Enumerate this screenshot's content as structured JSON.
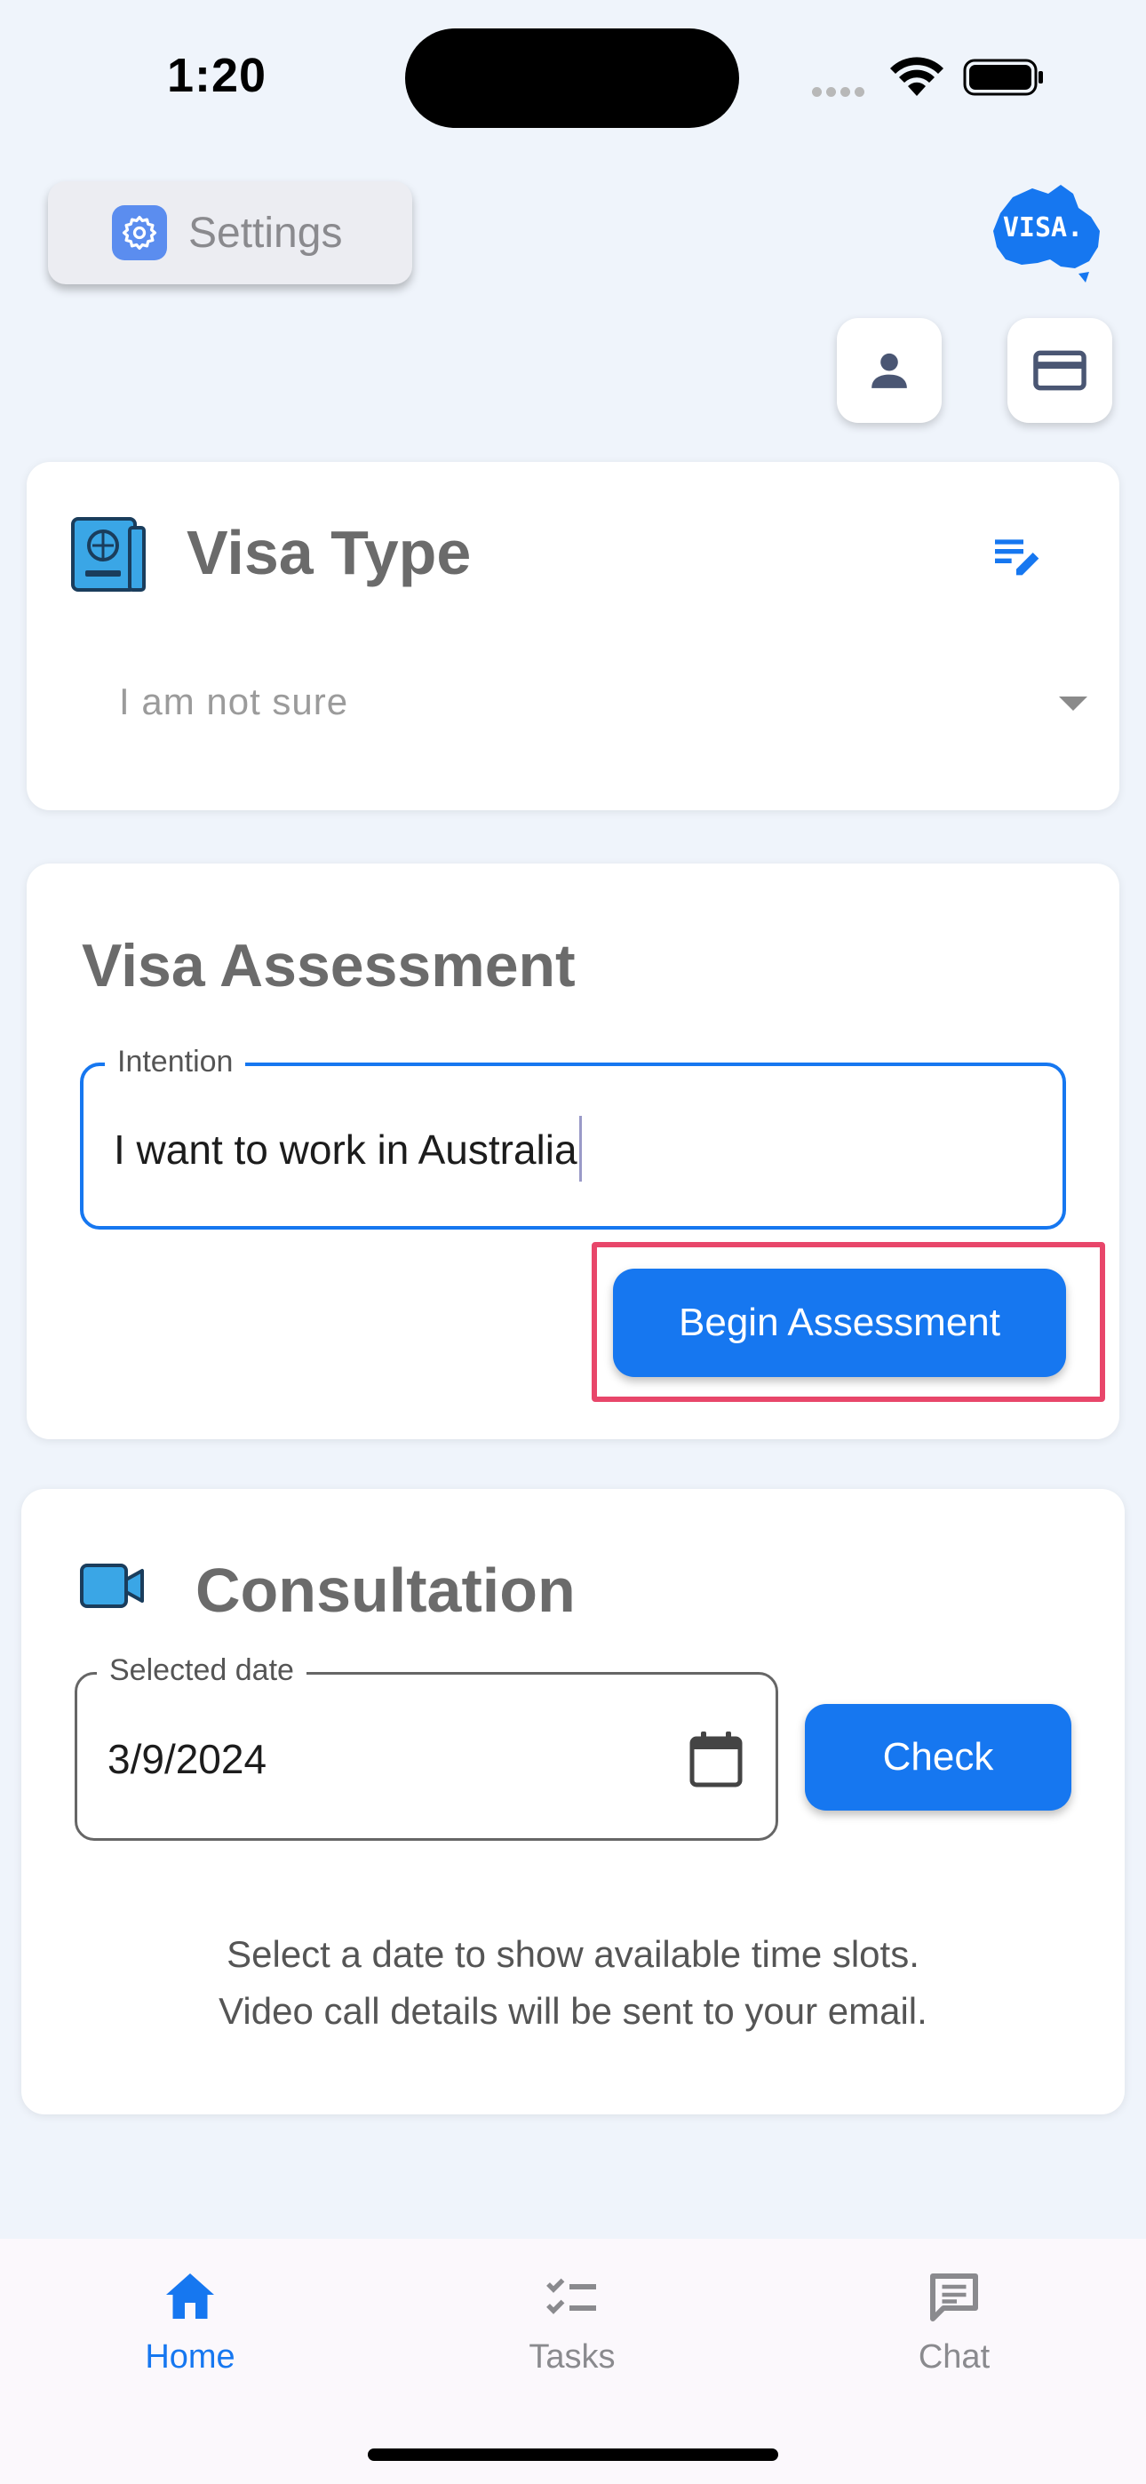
{
  "status_bar": {
    "time": "1:20"
  },
  "header": {
    "settings_label": "Settings",
    "logo_text": "VISA."
  },
  "visa_type": {
    "title": "Visa Type",
    "selected": "I am not sure"
  },
  "assessment": {
    "title": "Visa Assessment",
    "intention_label": "Intention",
    "intention_value": "I want to work in Australia",
    "begin_label": "Begin Assessment"
  },
  "consultation": {
    "title": "Consultation",
    "date_label": "Selected date",
    "date_value": "3/9/2024",
    "check_label": "Check",
    "note_line1": "Select a date to show available time slots.",
    "note_line2": "Video call details will be sent to your email."
  },
  "nav": {
    "home": "Home",
    "tasks": "Tasks",
    "chat": "Chat",
    "active": "home"
  },
  "colors": {
    "accent": "#1677f0",
    "background": "#eff4fb",
    "highlight": "#e8466a"
  }
}
